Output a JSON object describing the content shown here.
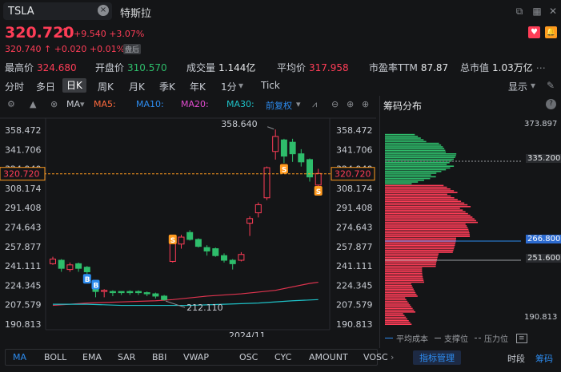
{
  "search": {
    "value": "TSLA",
    "clear": "×"
  },
  "stock_name": "特斯拉",
  "price": {
    "last": "320.720",
    "change": "+9.540",
    "change_pct": "+3.07%",
    "after_hours": "320.740 ↑ +0.020 +0.01%",
    "ah_badge": "盘后"
  },
  "stats": [
    {
      "label": "最高价",
      "value": "324.680",
      "color": "#ff3d57"
    },
    {
      "label": "开盘价",
      "value": "310.570",
      "color": "#2ebd6b"
    },
    {
      "label": "成交量",
      "value": "1.144亿",
      "color": "#e6e8ea"
    },
    {
      "label": "平均价",
      "value": "317.958",
      "color": "#ff3d57"
    },
    {
      "label": "市盈率TTM",
      "value": "87.87",
      "color": "#e6e8ea"
    },
    {
      "label": "总市值",
      "value": "1.03万亿",
      "color": "#e6e8ea"
    }
  ],
  "periods": [
    "分时",
    "多日",
    "日K",
    "周K",
    "月K",
    "季K",
    "年K",
    "1分",
    "Tick"
  ],
  "period_active": "日K",
  "display_label": "显示",
  "chart_toolbar": {
    "ma": "MA",
    "ma5": "MA5:",
    "ma10": "MA10:",
    "ma20": "MA20:",
    "ma30": "MA30:",
    "adjust": "前复权",
    "colors": {
      "ma5": "#ff6a3d",
      "ma10": "#2d8cf0",
      "ma20": "#e24cd0",
      "ma30": "#1ec1c7"
    }
  },
  "chart_data": {
    "type": "candlestick",
    "y_ticks": [
      "358.472",
      "341.706",
      "324.940",
      "308.174",
      "291.408",
      "274.643",
      "257.877",
      "241.111",
      "224.345",
      "207.579",
      "190.813"
    ],
    "ylim": [
      190.813,
      375
    ],
    "x_label": "2024/11",
    "current_price": "320.720",
    "high_annotation": "358.640",
    "low_annotation": "212.110",
    "candles": [
      {
        "o": 243,
        "c": 247,
        "h": 249,
        "l": 242
      },
      {
        "o": 246,
        "c": 239,
        "h": 247,
        "l": 236
      },
      {
        "o": 238,
        "c": 242,
        "h": 244,
        "l": 236
      },
      {
        "o": 243,
        "c": 239,
        "h": 244,
        "l": 236
      },
      {
        "o": 240,
        "c": 236,
        "h": 241,
        "l": 232
      },
      {
        "o": 221,
        "c": 219,
        "h": 222,
        "l": 214
      },
      {
        "o": 219,
        "c": 220,
        "h": 221,
        "l": 214
      },
      {
        "o": 219,
        "c": 218,
        "h": 220,
        "l": 215
      },
      {
        "o": 219,
        "c": 218,
        "h": 219,
        "l": 216
      },
      {
        "o": 219,
        "c": 218,
        "h": 220,
        "l": 216
      },
      {
        "o": 219,
        "c": 218,
        "h": 220,
        "l": 216
      },
      {
        "o": 218,
        "c": 217,
        "h": 219,
        "l": 215
      },
      {
        "o": 217,
        "c": 215,
        "h": 218,
        "l": 213
      },
      {
        "o": 215,
        "c": 212,
        "h": 216,
        "l": 211
      },
      {
        "o": 245,
        "c": 261,
        "h": 262,
        "l": 244
      },
      {
        "o": 260,
        "c": 266,
        "h": 268,
        "l": 256
      },
      {
        "o": 270,
        "c": 264,
        "h": 272,
        "l": 263
      },
      {
        "o": 264,
        "c": 258,
        "h": 265,
        "l": 257
      },
      {
        "o": 257,
        "c": 254,
        "h": 259,
        "l": 250
      },
      {
        "o": 256,
        "c": 250,
        "h": 257,
        "l": 249
      },
      {
        "o": 250,
        "c": 246,
        "h": 252,
        "l": 244
      },
      {
        "o": 246,
        "c": 243,
        "h": 247,
        "l": 238
      },
      {
        "o": 246,
        "c": 251,
        "h": 253,
        "l": 245
      },
      {
        "o": 278,
        "c": 282,
        "h": 284,
        "l": 267
      },
      {
        "o": 287,
        "c": 294,
        "h": 296,
        "l": 283
      },
      {
        "o": 300,
        "c": 326,
        "h": 327,
        "l": 298
      },
      {
        "o": 340,
        "c": 353,
        "h": 359,
        "l": 333
      },
      {
        "o": 350,
        "c": 336,
        "h": 351,
        "l": 330
      },
      {
        "o": 348,
        "c": 338,
        "h": 351,
        "l": 331
      },
      {
        "o": 338,
        "c": 331,
        "h": 342,
        "l": 327
      },
      {
        "o": 333,
        "c": 318,
        "h": 334,
        "l": 314
      },
      {
        "o": 311,
        "c": 321,
        "h": 325,
        "l": 310
      }
    ],
    "ma_red": [
      [
        0,
        207
      ],
      [
        4,
        209
      ],
      [
        8,
        210
      ],
      [
        12,
        211
      ],
      [
        14,
        212
      ],
      [
        18,
        215
      ],
      [
        22,
        217
      ],
      [
        26,
        220
      ],
      [
        30,
        226
      ],
      [
        31,
        227
      ]
    ],
    "ma_teal": [
      [
        0,
        208
      ],
      [
        4,
        208
      ],
      [
        8,
        207
      ],
      [
        12,
        207
      ],
      [
        16,
        207
      ],
      [
        20,
        208
      ],
      [
        24,
        209
      ],
      [
        28,
        211
      ],
      [
        31,
        212
      ]
    ],
    "event_markers": [
      {
        "idx": 4,
        "label": "B",
        "color": "#2d8cf0",
        "y": 230
      },
      {
        "idx": 5,
        "label": "B",
        "color": "#2d8cf0",
        "y": 225
      },
      {
        "idx": 14,
        "label": "S",
        "color": "#ff9a1f",
        "y": 264
      },
      {
        "idx": 27,
        "label": "S",
        "color": "#ff9a1f",
        "y": 325
      },
      {
        "idx": 31,
        "label": "S",
        "color": "#ff9a1f",
        "y": 306
      }
    ]
  },
  "chip_panel": {
    "title": "筹码分布",
    "help": "?",
    "top": "373.897",
    "bottom": "190.813",
    "label_1": "335.200",
    "label_2": "266.800",
    "label_3": "251.600",
    "legend_avg": "平均成本",
    "legend_support": "支撑位",
    "legend_resist": "压力位"
  },
  "indicators": [
    "MA",
    "BOLL",
    "EMA",
    "SAR",
    "BBI",
    "VWAP",
    "OSC",
    "CYC",
    "AMOUNT",
    "VOSC"
  ],
  "indicator_manage": "指标管理",
  "bottom_right": {
    "time_label": "时段",
    "chip_label": "筹码"
  }
}
